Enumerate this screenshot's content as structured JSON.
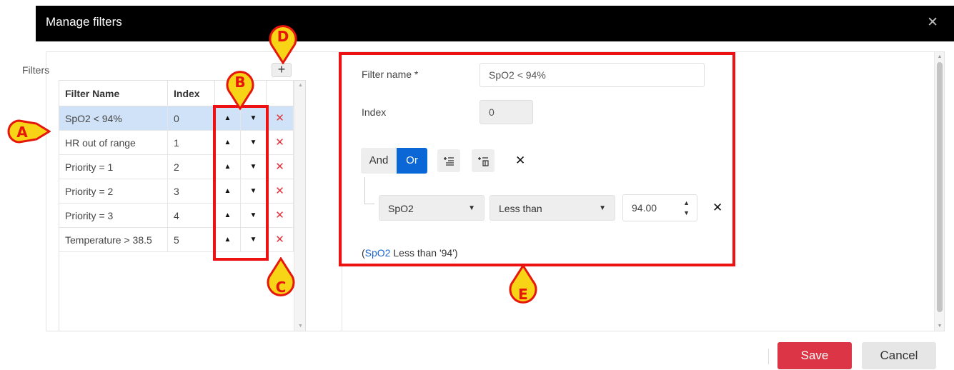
{
  "dialog": {
    "title": "Manage filters",
    "close_icon": "close-icon"
  },
  "filters_panel": {
    "label": "Filters",
    "add_label": "+",
    "columns": [
      "Filter Name",
      "Index"
    ],
    "rows": [
      {
        "name": "SpO2 < 94%",
        "index": "0"
      },
      {
        "name": "HR out of range",
        "index": "1"
      },
      {
        "name": "Priority = 1",
        "index": "2"
      },
      {
        "name": "Priority = 2",
        "index": "3"
      },
      {
        "name": "Priority = 3",
        "index": "4"
      },
      {
        "name": "Temperature > 38.5",
        "index": "5"
      }
    ],
    "selected_row": 0,
    "up_symbol": "▲",
    "down_symbol": "▼",
    "delete_symbol": "✕"
  },
  "editor": {
    "filter_name_label": "Filter name *",
    "filter_name_value": "SpO2 < 94%",
    "index_label": "Index",
    "index_value": "0",
    "and_label": "And",
    "or_label": "Or",
    "remove_group_symbol": "✕",
    "condition": {
      "field": "SpO2",
      "operator": "Less than",
      "value": "94.00",
      "remove_symbol": "✕"
    },
    "expression": {
      "open": "(",
      "field": "SpO2",
      "rest": " Less than '94')"
    }
  },
  "annotations": {
    "a": "A",
    "b": "B",
    "c": "C",
    "d": "D",
    "e": "E"
  },
  "footer": {
    "save_label": "Save",
    "cancel_label": "Cancel"
  },
  "colors": {
    "primary": "#0b66d6",
    "danger": "#dc3545",
    "annotation": "#ee1111",
    "marker_fill": "#f7d416",
    "selected_row": "#cfe2f7"
  }
}
